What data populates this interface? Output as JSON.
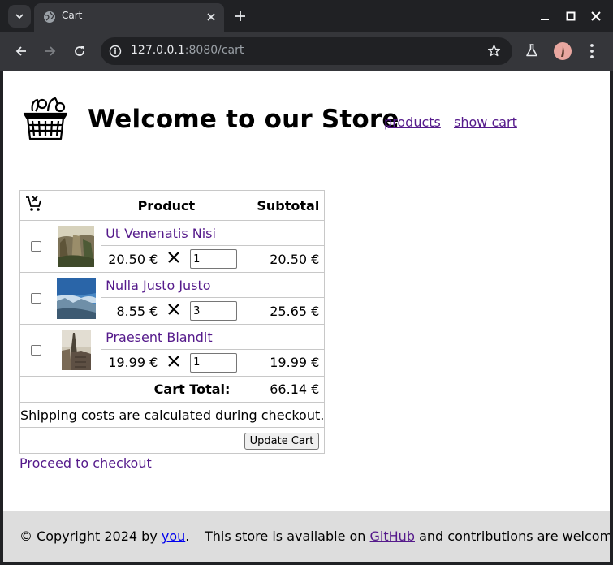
{
  "browser": {
    "tab_title": "Cart",
    "url_host": "127.0.0.1",
    "url_rest": ":8080/cart"
  },
  "header": {
    "title": "Welcome to our Store",
    "nav": [
      "products",
      "show cart"
    ]
  },
  "cart": {
    "col_product": "Product",
    "col_subtotal": "Subtotal",
    "items": [
      {
        "name": "Ut Venenatis Nisi",
        "price": "20.50 €",
        "qty": "1",
        "subtotal": "20.50 €"
      },
      {
        "name": "Nulla Justo Justo",
        "price": "8.55 €",
        "qty": "3",
        "subtotal": "25.65 €"
      },
      {
        "name": "Praesent Blandit",
        "price": "19.99 €",
        "qty": "1",
        "subtotal": "19.99 €"
      }
    ],
    "total_label": "Cart Total:",
    "total_value": "66.14 €",
    "shipping_note": "Shipping costs are calculated during checkout.",
    "update_label": "Update Cart",
    "checkout_label": "Proceed to checkout"
  },
  "footer": {
    "copyright": "© Copyright 2024 by",
    "you": "you",
    "period": ".",
    "available": "This store is available on",
    "github": "GitHub",
    "contrib": "and contributions are welcome."
  }
}
